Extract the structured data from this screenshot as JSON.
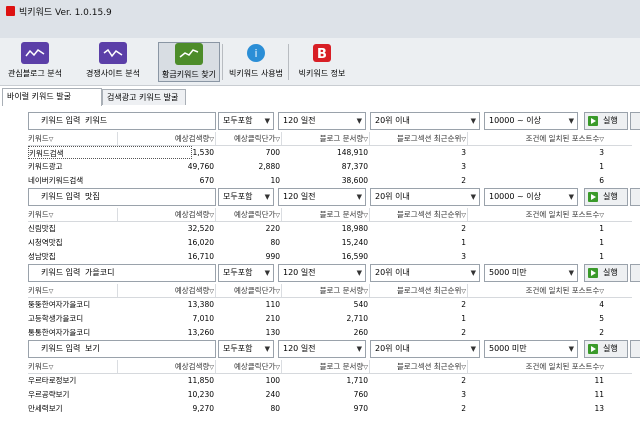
{
  "app": {
    "title": "빅키워드 Ver. 1.0.15.9"
  },
  "toolbar": {
    "items": [
      {
        "label": "관심블로그 분석",
        "icon": "blog-analysis-icon",
        "color": "#5b3fa8"
      },
      {
        "label": "경쟁사이트 분석",
        "icon": "competitor-analysis-icon",
        "color": "#5b3fa8"
      },
      {
        "label": "황금키워드 찾기",
        "icon": "golden-keyword-icon",
        "color": "#4d8c2a"
      },
      {
        "label": "빅키워드 사용법",
        "icon": "help-info-icon",
        "color": "#2b8ed6"
      },
      {
        "label": "빅키워드 정보",
        "icon": "bigkeyword-logo-icon",
        "color": "#d81f26"
      }
    ]
  },
  "tabs": [
    "바이럴 키워드 발굴",
    "검색광고 키워드 발굴"
  ],
  "columns": [
    "키워드",
    "예상검색량",
    "예상클릭단가",
    "블로그 문서량",
    "블로그섹션 최근순위",
    "조건에 일치된 포스트수"
  ],
  "panels": [
    {
      "keyword_label": "키워드 입력",
      "keyword_value": "키워드",
      "filter": "모두포함",
      "period": "120 일전",
      "rank": "20위 이내",
      "volume": "10000 ~ 이상",
      "run": "실행",
      "rows": [
        [
          "키워드검색",
          "1,530",
          "700",
          "148,910",
          "3",
          "3"
        ],
        [
          "키워드광고",
          "49,760",
          "2,880",
          "87,370",
          "3",
          "1"
        ],
        [
          "네이버키워드검색",
          "670",
          "10",
          "38,600",
          "2",
          "6"
        ]
      ]
    },
    {
      "keyword_label": "키워드 입력",
      "keyword_value": "맛집",
      "filter": "모두포함",
      "period": "120 일전",
      "rank": "20위 이내",
      "volume": "10000 ~ 이상",
      "run": "실행",
      "rows": [
        [
          "신림맛집",
          "32,520",
          "220",
          "18,980",
          "2",
          "1"
        ],
        [
          "시청역맛집",
          "16,020",
          "80",
          "15,240",
          "1",
          "1"
        ],
        [
          "성남맛집",
          "16,710",
          "990",
          "16,590",
          "3",
          "1"
        ]
      ]
    },
    {
      "keyword_label": "키워드 입력",
      "keyword_value": "가을코디",
      "filter": "모두포함",
      "period": "120 일전",
      "rank": "20위 이내",
      "volume": "5000 미만",
      "run": "실행",
      "rows": [
        [
          "뚱뚱한여자가을코디",
          "13,380",
          "110",
          "540",
          "2",
          "4"
        ],
        [
          "고등학생가을코디",
          "7,010",
          "210",
          "2,710",
          "1",
          "5"
        ],
        [
          "통통한여자가을코디",
          "13,260",
          "130",
          "260",
          "2",
          "2"
        ]
      ]
    },
    {
      "keyword_label": "키워드 입력",
      "keyword_value": "보기",
      "filter": "모두포함",
      "period": "120 일전",
      "rank": "20위 이내",
      "volume": "5000 미만",
      "run": "실행",
      "rows": [
        [
          "우르타로정보기",
          "11,850",
          "100",
          "1,710",
          "2",
          "11"
        ],
        [
          "우르공략보기",
          "10,230",
          "240",
          "760",
          "3",
          "11"
        ],
        [
          "만세력보기",
          "9,270",
          "80",
          "970",
          "2",
          "13"
        ]
      ]
    }
  ]
}
